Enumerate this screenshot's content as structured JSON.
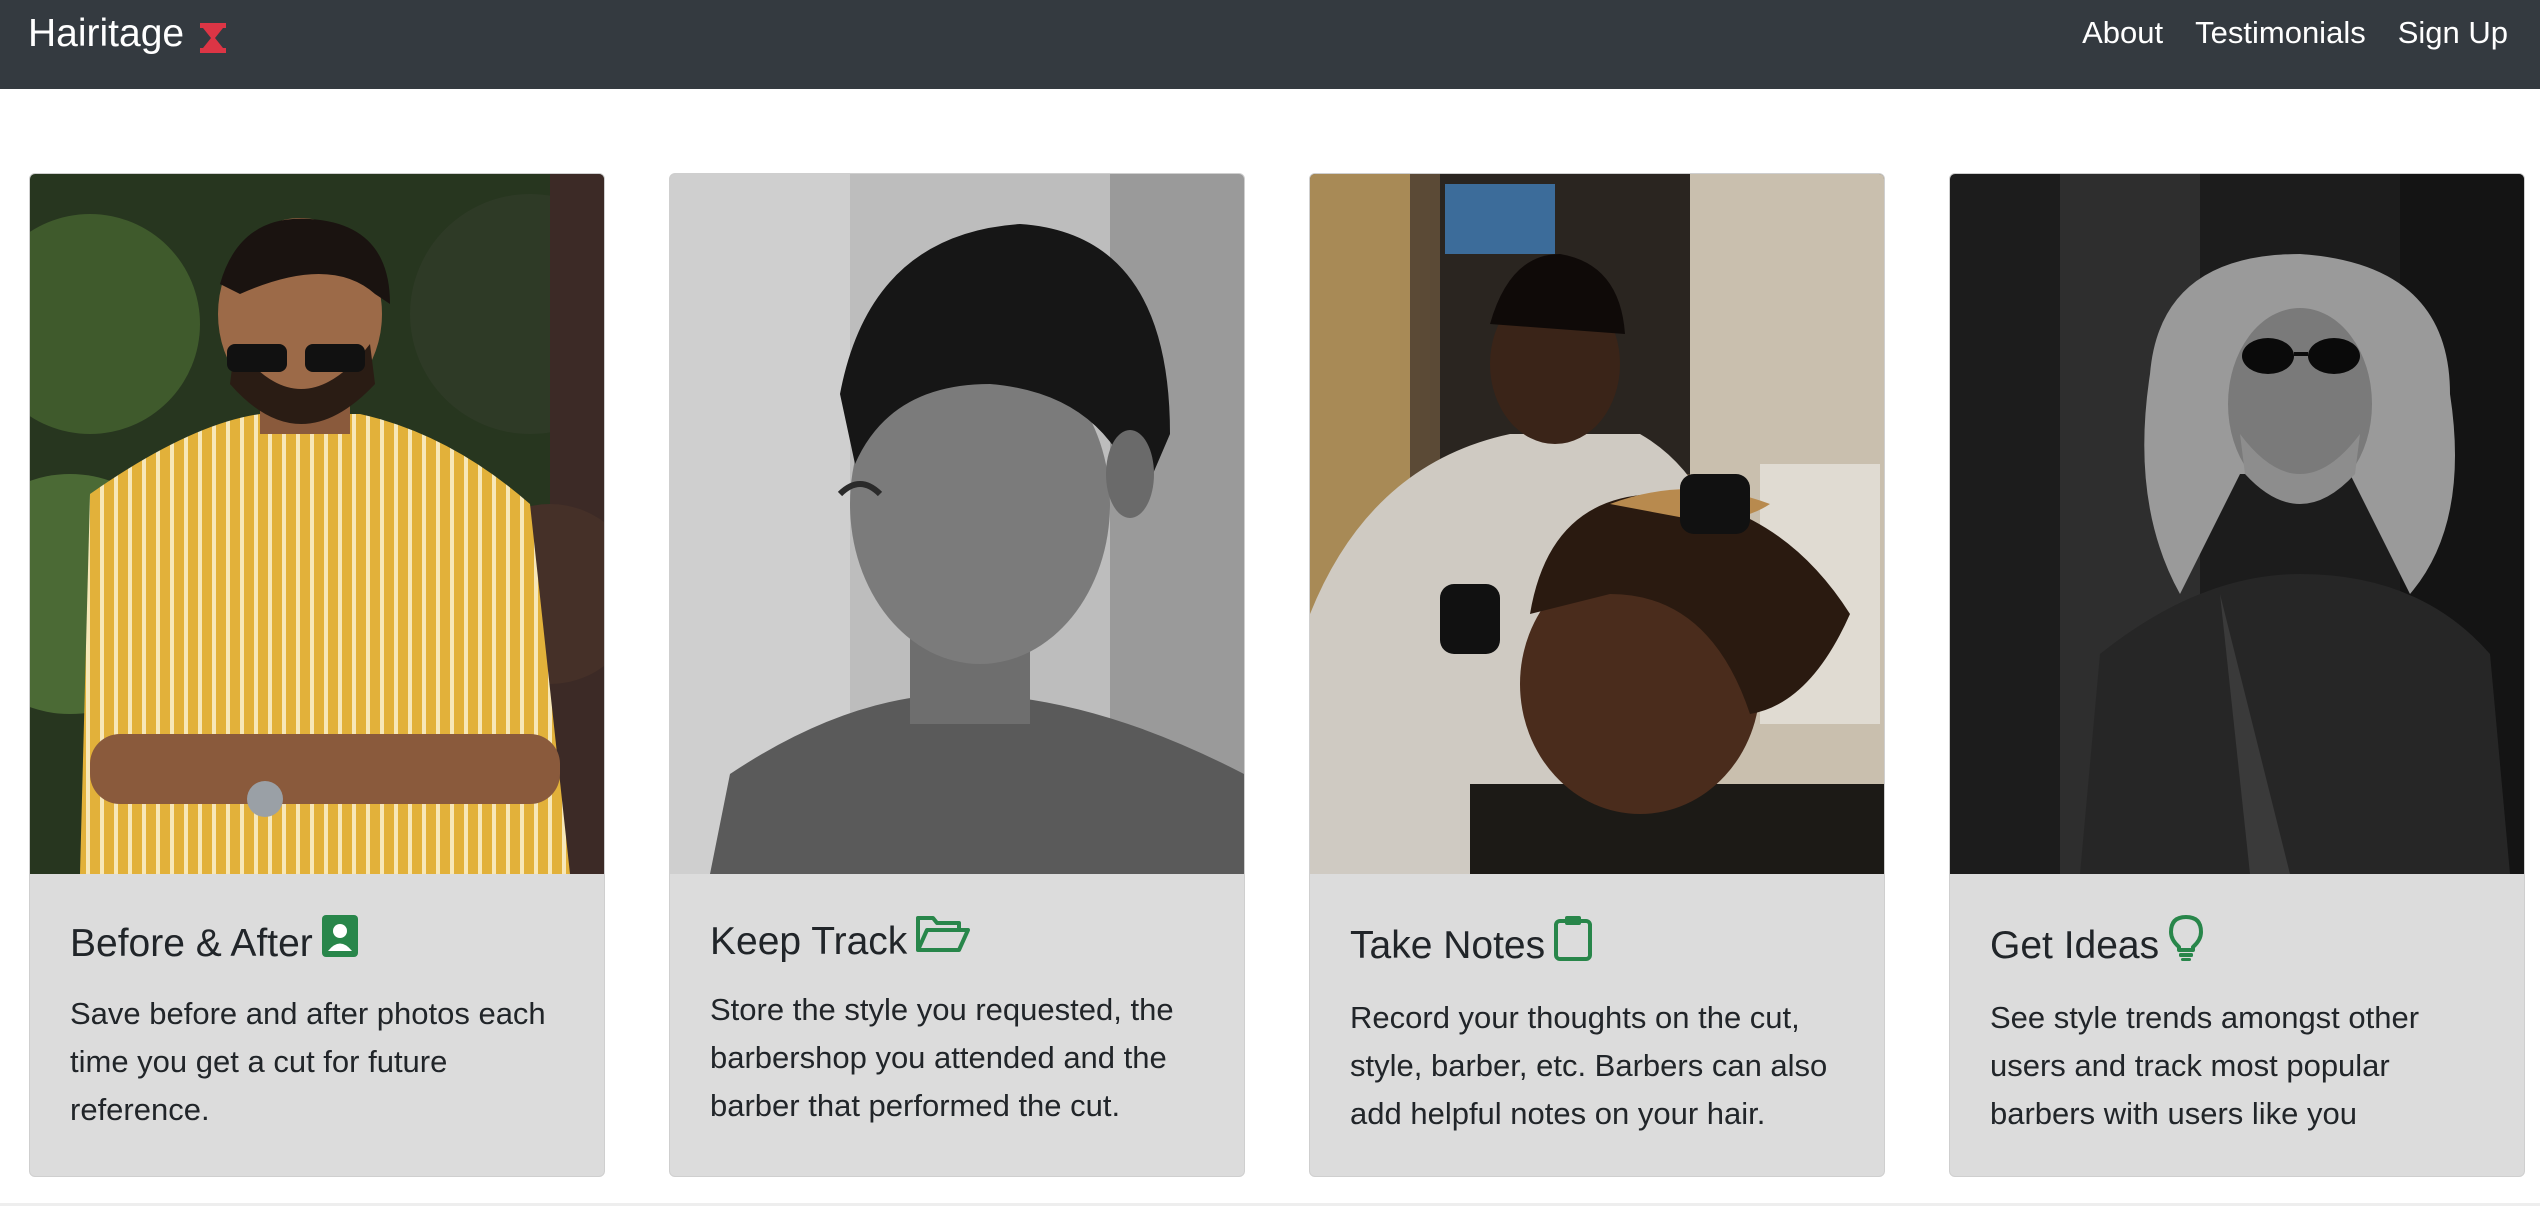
{
  "navbar": {
    "brand": "Hairitage",
    "brand_icon": "hourglass-icon",
    "brand_icon_color": "#dc3545",
    "links": [
      "About",
      "Testimonials",
      "Sign Up"
    ]
  },
  "accent_color": "#28864a",
  "cards": [
    {
      "title": "Before & After",
      "icon": "person-badge-icon",
      "text": "Save before and after photos each time you get a cut for future reference.",
      "image": "man-in-yellow-striped-shirt-photo"
    },
    {
      "title": "Keep Track",
      "icon": "folder-open-icon",
      "text": "Store the style you requested, the barbershop you attended and the barber that performed the cut.",
      "image": "black-and-white-portrait-photo"
    },
    {
      "title": "Take Notes",
      "icon": "clipboard-icon",
      "text": "Record your thoughts on the cut, style, barber, etc. Barbers can also add helpful notes on your hair.",
      "image": "barber-cutting-hair-photo"
    },
    {
      "title": "Get Ideas",
      "icon": "lightbulb-icon",
      "text": "See style trends amongst other users and track most popular barbers with users like you",
      "image": "man-with-long-curly-hair-photo"
    }
  ]
}
